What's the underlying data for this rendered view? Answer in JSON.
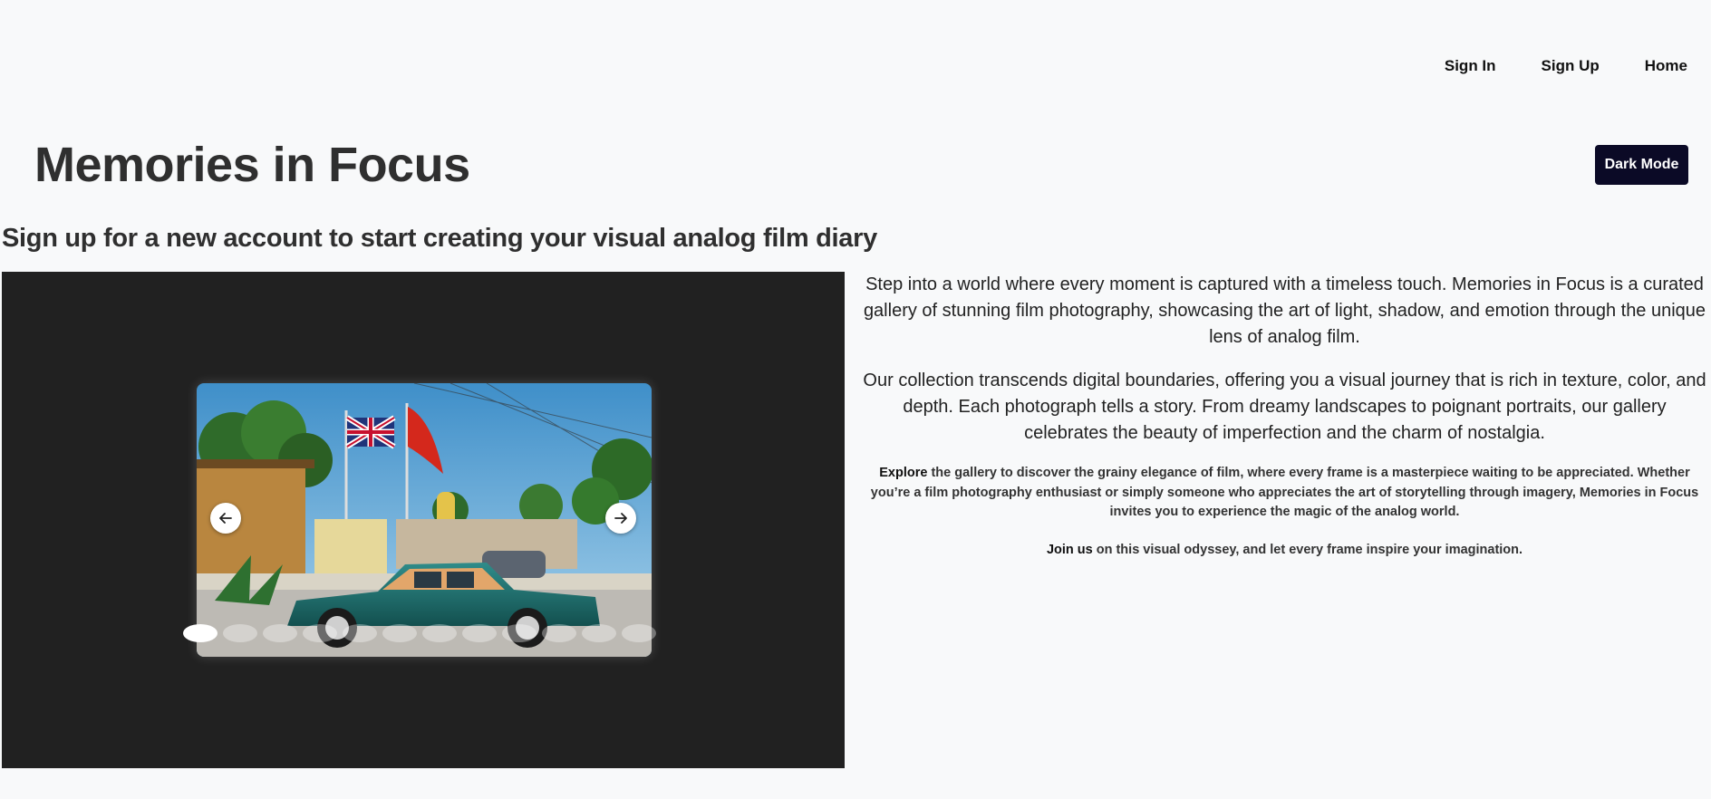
{
  "nav": {
    "sign_in": "Sign In",
    "sign_up": "Sign Up",
    "home": "Home"
  },
  "header": {
    "title": "Memories in Focus",
    "dark_mode_label": "Dark Mode",
    "subtitle": "Sign up for a new account to start creating your visual analog film diary"
  },
  "gallery": {
    "slide_count": 12,
    "active_slide": 1,
    "prev_icon": "arrow-left-icon",
    "next_icon": "arrow-right-icon",
    "background_color": "#212121"
  },
  "intro": {
    "p1": "Step into a world where every moment is captured with a timeless touch. Memories in Focus is a curated gallery of stunning film photography, showcasing the art of light, shadow, and emotion through the unique lens of analog film.",
    "p2": "Our collection transcends digital boundaries, offering you a visual journey that is rich in texture, color, and depth. Each photograph tells a story. From dreamy landscapes to poignant portraits, our gallery celebrates the beauty of imperfection and the charm of nostalgia.",
    "p3_lead": "Explore",
    "p3_rest": " the gallery to discover the grainy elegance of film, where every frame is a masterpiece waiting to be appreciated. Whether you’re a film photography enthusiast or simply someone who appreciates the art of storytelling through imagery, Memories in Focus invites you to experience the magic of the analog world.",
    "p4_lead": "Join us",
    "p4_rest": " on this visual odyssey, and let every frame inspire your imagination."
  },
  "colors": {
    "page_bg": "#f8f9fa",
    "dark_button": "#0b0a26",
    "text": "#222222"
  }
}
